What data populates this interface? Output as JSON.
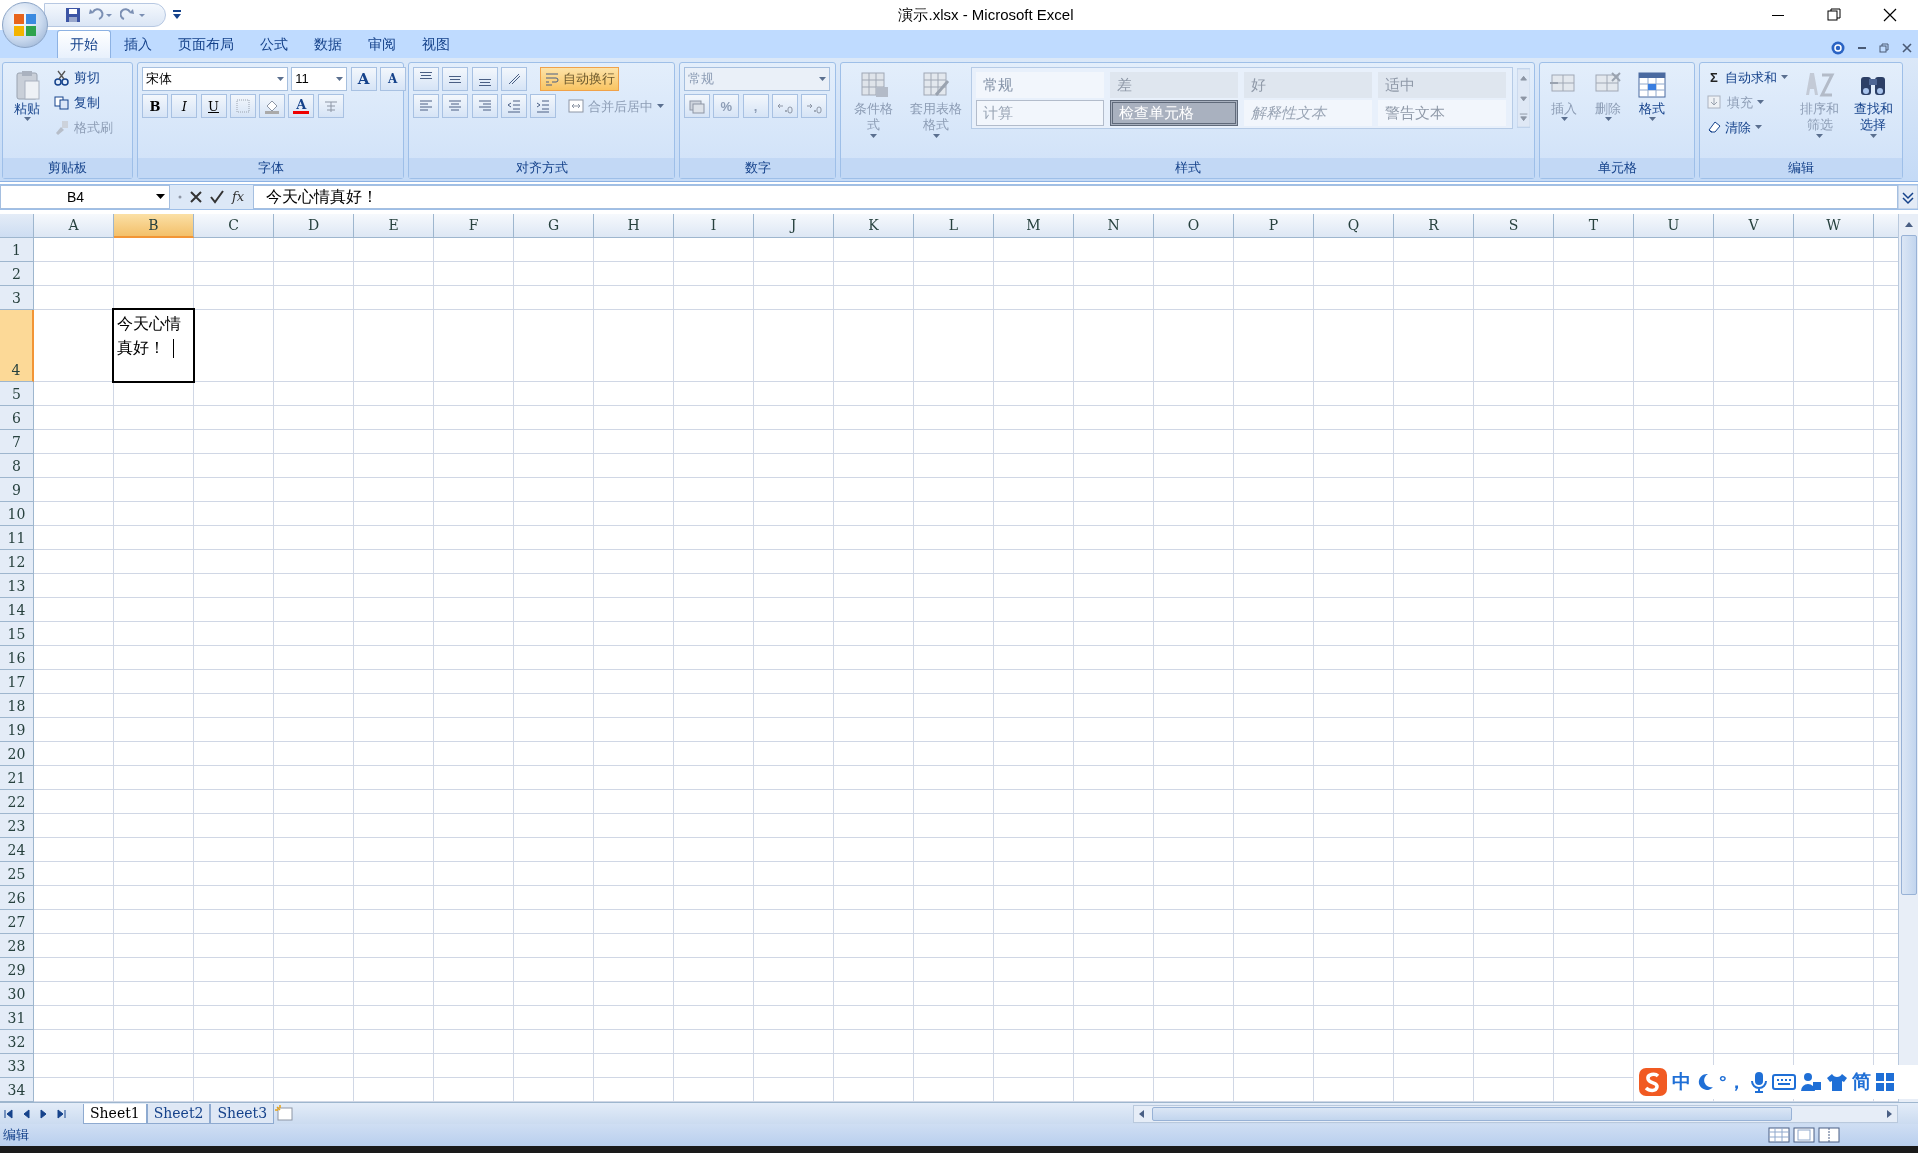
{
  "window": {
    "title": "演示.xlsx - Microsoft Excel"
  },
  "tabs": [
    {
      "label": "开始",
      "selected": true
    },
    {
      "label": "插入",
      "selected": false
    },
    {
      "label": "页面布局",
      "selected": false
    },
    {
      "label": "公式",
      "selected": false
    },
    {
      "label": "数据",
      "selected": false
    },
    {
      "label": "审阅",
      "selected": false
    },
    {
      "label": "视图",
      "selected": false
    }
  ],
  "ribbon": {
    "groups": [
      {
        "kind": "clipboard",
        "label": "剪贴板",
        "items": [
          {
            "kind": "paste",
            "label": "粘贴",
            "disabled": false
          },
          {
            "kind": "cut",
            "label": "剪切",
            "disabled": false
          },
          {
            "kind": "copy",
            "label": "复制",
            "disabled": false
          },
          {
            "kind": "painter",
            "label": "格式刷",
            "disabled": true
          }
        ]
      },
      {
        "kind": "font",
        "label": "字体",
        "items": [
          {
            "value": "宋体"
          },
          {
            "value": "11"
          },
          {
            "label": "A",
            "disabled": false
          },
          {
            "label": "A",
            "disabled": false
          },
          {
            "label": "B",
            "disabled": false
          },
          {
            "label": "I",
            "disabled": false
          },
          {
            "label": "U",
            "disabled": false
          },
          {
            "label": "A",
            "disabled": false
          }
        ]
      },
      {
        "kind": "alignment",
        "label": "对齐方式",
        "items": [
          {
            "label": "自动换行",
            "selected": true,
            "disabled": false
          },
          {
            "label": "合并后居中",
            "selected": false,
            "disabled": true
          }
        ]
      },
      {
        "kind": "number",
        "label": "数字",
        "items": [
          {
            "value": "常规",
            "disabled": true
          },
          {
            "label": "%",
            "disabled": true
          },
          {
            "label": ",",
            "disabled": true
          }
        ]
      },
      {
        "kind": "styles",
        "label": "样式",
        "buttons": [
          {
            "kind": "conditional",
            "label": "条件格式",
            "disabled": true
          },
          {
            "kind": "tableformat",
            "label": "套用表格格式",
            "disabled": true
          }
        ],
        "gallery": [
          {
            "kind": "normal",
            "label": "常规"
          },
          {
            "kind": "bad",
            "label": "差"
          },
          {
            "kind": "good",
            "label": "好"
          },
          {
            "kind": "neutral",
            "label": "适中"
          },
          {
            "kind": "calculation",
            "label": "计算"
          },
          {
            "kind": "check",
            "label": "检查单元格"
          },
          {
            "kind": "explanatory",
            "label": "解释性文本"
          },
          {
            "kind": "warning",
            "label": "警告文本"
          }
        ]
      },
      {
        "kind": "cells",
        "label": "单元格",
        "items": [
          {
            "kind": "insert",
            "label": "插入",
            "disabled": true
          },
          {
            "kind": "delete",
            "label": "删除",
            "disabled": true
          },
          {
            "kind": "format",
            "label": "格式",
            "disabled": false
          }
        ]
      },
      {
        "kind": "editing",
        "label": "编辑",
        "items": [
          {
            "symbol": "Σ",
            "label": "自动求和",
            "disabled": false
          },
          {
            "kind": "fill",
            "label": "填充",
            "disabled": true
          },
          {
            "kind": "clear",
            "label": "清除",
            "disabled": false
          },
          {
            "kind": "sort",
            "label": "排序和筛选",
            "disabled": true
          },
          {
            "kind": "find",
            "label": "查找和选择",
            "disabled": false
          }
        ]
      }
    ]
  },
  "formula_bar": {
    "name_box": "B4",
    "function_label": "fx",
    "content": "今天心情真好！"
  },
  "columns": [
    {
      "label": "A",
      "selected": false
    },
    {
      "label": "B",
      "selected": true
    },
    {
      "label": "C",
      "selected": false
    },
    {
      "label": "D",
      "selected": false
    },
    {
      "label": "E",
      "selected": false
    },
    {
      "label": "F",
      "selected": false
    },
    {
      "label": "G",
      "selected": false
    },
    {
      "label": "H",
      "selected": false
    },
    {
      "label": "I",
      "selected": false
    },
    {
      "label": "J",
      "selected": false
    },
    {
      "label": "K",
      "selected": false
    },
    {
      "label": "L",
      "selected": false
    },
    {
      "label": "M",
      "selected": false
    },
    {
      "label": "N",
      "selected": false
    },
    {
      "label": "O",
      "selected": false
    },
    {
      "label": "P",
      "selected": false
    },
    {
      "label": "Q",
      "selected": false
    },
    {
      "label": "R",
      "selected": false
    },
    {
      "label": "S",
      "selected": false
    },
    {
      "label": "T",
      "selected": false
    },
    {
      "label": "U",
      "selected": false
    },
    {
      "label": "V",
      "selected": false
    },
    {
      "label": "W",
      "selected": false
    }
  ],
  "rows": [
    {
      "label": "1",
      "selected": false,
      "tall": false
    },
    {
      "label": "2",
      "selected": false,
      "tall": false
    },
    {
      "label": "3",
      "selected": false,
      "tall": false
    },
    {
      "label": "4",
      "selected": true,
      "tall": true
    },
    {
      "label": "5",
      "selected": false,
      "tall": false
    },
    {
      "label": "6",
      "selected": false,
      "tall": false
    },
    {
      "label": "7",
      "selected": false,
      "tall": false
    },
    {
      "label": "8",
      "selected": false,
      "tall": false
    },
    {
      "label": "9",
      "selected": false,
      "tall": false
    },
    {
      "label": "10",
      "selected": false,
      "tall": false
    },
    {
      "label": "11",
      "selected": false,
      "tall": false
    },
    {
      "label": "12",
      "selected": false,
      "tall": false
    },
    {
      "label": "13",
      "selected": false,
      "tall": false
    },
    {
      "label": "14",
      "selected": false,
      "tall": false
    },
    {
      "label": "15",
      "selected": false,
      "tall": false
    },
    {
      "label": "16",
      "selected": false,
      "tall": false
    },
    {
      "label": "17",
      "selected": false,
      "tall": false
    },
    {
      "label": "18",
      "selected": false,
      "tall": false
    },
    {
      "label": "19",
      "selected": false,
      "tall": false
    },
    {
      "label": "20",
      "selected": false,
      "tall": false
    },
    {
      "label": "21",
      "selected": false,
      "tall": false
    },
    {
      "label": "22",
      "selected": false,
      "tall": false
    },
    {
      "label": "23",
      "selected": false,
      "tall": false
    },
    {
      "label": "24",
      "selected": false,
      "tall": false
    },
    {
      "label": "25",
      "selected": false,
      "tall": false
    },
    {
      "label": "26",
      "selected": false,
      "tall": false
    },
    {
      "label": "27",
      "selected": false,
      "tall": false
    },
    {
      "label": "28",
      "selected": false,
      "tall": false
    },
    {
      "label": "29",
      "selected": false,
      "tall": false
    },
    {
      "label": "30",
      "selected": false,
      "tall": false
    },
    {
      "label": "31",
      "selected": false,
      "tall": false
    },
    {
      "label": "32",
      "selected": false,
      "tall": false
    },
    {
      "label": "33",
      "selected": false,
      "tall": false
    },
    {
      "label": "34",
      "selected": false,
      "tall": false
    }
  ],
  "active_cell": {
    "text": "今天心情真好！"
  },
  "sheets": [
    {
      "label": "Sheet1",
      "selected": true
    },
    {
      "label": "Sheet2",
      "selected": false
    },
    {
      "label": "Sheet3",
      "selected": false
    }
  ],
  "status_bar": {
    "mode": "编辑"
  },
  "ime_toolbar": {
    "language": "中",
    "punctuation": "°，",
    "script": "简"
  }
}
